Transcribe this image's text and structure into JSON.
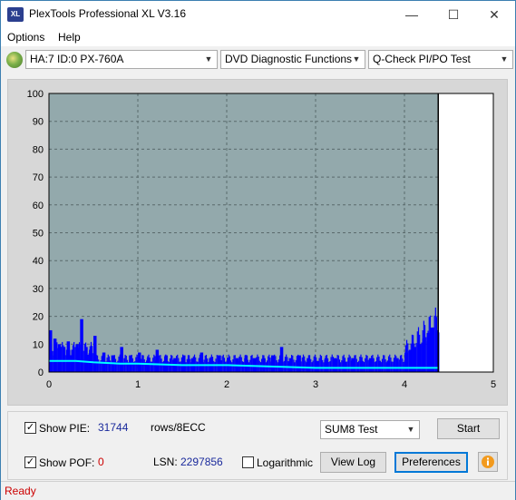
{
  "window": {
    "title": "PlexTools Professional XL V3.16",
    "icon_text": "XL",
    "minimize": "—",
    "maximize": "☐",
    "close": "✕"
  },
  "menu": {
    "items": [
      {
        "label": "Options"
      },
      {
        "label": "Help"
      }
    ]
  },
  "toolbar": {
    "drive": "HA:7 ID:0  PX-760A",
    "function": "DVD Diagnostic Functions",
    "test": "Q-Check PI/PO Test"
  },
  "chart_data": {
    "type": "area",
    "xlim": [
      0,
      5
    ],
    "ylim": [
      0,
      100
    ],
    "x_ticks": [
      "0",
      "1",
      "2",
      "3",
      "4",
      "5"
    ],
    "y_ticks": [
      "0",
      "10",
      "20",
      "30",
      "40",
      "50",
      "60",
      "70",
      "80",
      "90",
      "100"
    ],
    "grid": true,
    "end_marker_x": 4.38,
    "colors": {
      "background": "#93a9ac",
      "bars": "#0000ff",
      "line": "#00ffff",
      "unused": "#ffffff"
    },
    "series": [
      {
        "type": "bar",
        "x": [
          0.0,
          0.05,
          0.1,
          0.15,
          0.2,
          0.25,
          0.3,
          0.35,
          0.4,
          0.45,
          0.5,
          0.6,
          0.7,
          0.8,
          0.9,
          1.0,
          1.1,
          1.2,
          1.3,
          1.4,
          1.5,
          1.6,
          1.7,
          1.8,
          1.9,
          2.0,
          2.1,
          2.2,
          2.3,
          2.4,
          2.5,
          2.6,
          2.7,
          2.8,
          2.9,
          3.0,
          3.1,
          3.2,
          3.3,
          3.4,
          3.5,
          3.6,
          3.7,
          3.8,
          3.9,
          4.0,
          4.05,
          4.1,
          4.15,
          4.2,
          4.25,
          4.3,
          4.35
        ],
        "values": [
          15,
          12,
          10,
          9,
          11,
          8,
          10,
          19,
          9,
          8,
          13,
          7,
          6,
          9,
          6,
          7,
          5,
          8,
          6,
          5,
          6,
          5,
          7,
          5,
          6,
          5,
          5,
          6,
          5,
          5,
          6,
          9,
          5,
          6,
          5,
          4,
          5,
          5,
          4,
          5,
          4,
          5,
          4,
          4,
          5,
          7,
          8,
          9,
          10,
          12,
          14,
          16,
          15
        ]
      },
      {
        "type": "line",
        "x": [
          0.0,
          0.1,
          0.3,
          0.5,
          0.8,
          1.0,
          1.5,
          2.0,
          2.5,
          3.0,
          3.5,
          4.0,
          4.2,
          4.38
        ],
        "values": [
          4,
          4,
          4,
          3.5,
          3,
          3,
          2.5,
          2.5,
          2,
          1.5,
          1.5,
          1.5,
          1.5,
          1.5
        ]
      }
    ]
  },
  "controls": {
    "show_pie_label": "Show PIE:",
    "show_pie_value": "31744",
    "unit": "rows/8ECC",
    "show_pof_label": "Show POF:",
    "show_pof_value": "0",
    "lsn_label": "LSN:",
    "lsn_value": "2297856",
    "logarithmic_label": "Logarithmic",
    "test_mode": "SUM8 Test",
    "start": "Start",
    "view_log": "View Log",
    "preferences": "Preferences",
    "check": "✓"
  },
  "status": {
    "text": "Ready"
  }
}
